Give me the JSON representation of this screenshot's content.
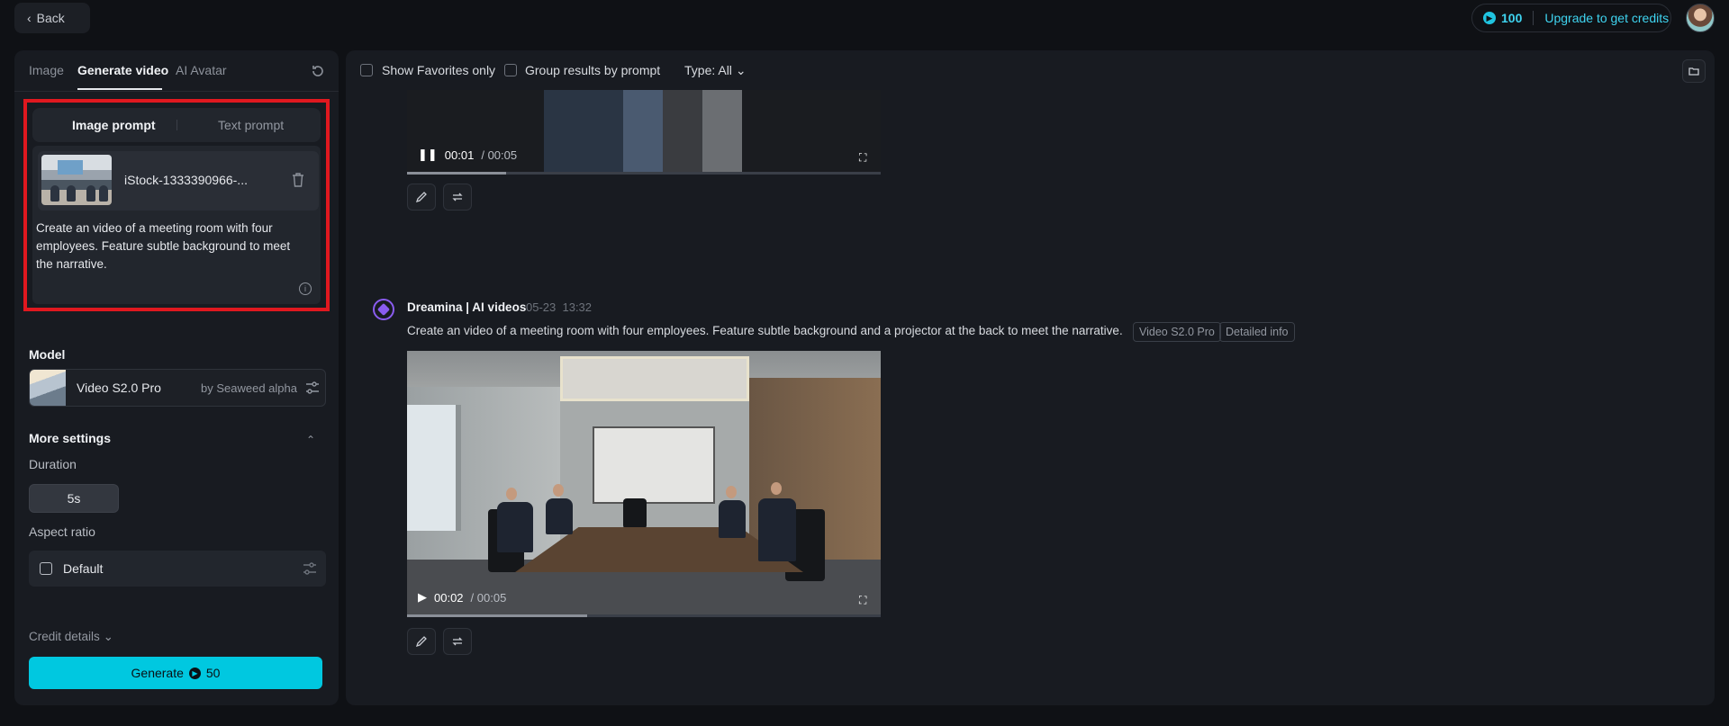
{
  "topbar": {
    "back_label": "Back",
    "credits": "100",
    "upgrade_label": "Upgrade to get credits"
  },
  "left": {
    "tabs": [
      {
        "label": "Image"
      },
      {
        "label": "Generate video"
      },
      {
        "label": "AI Avatar"
      }
    ],
    "prompt_tabs": {
      "image": "Image prompt",
      "text": "Text prompt"
    },
    "file_name": "iStock-1333390966-...",
    "prompt_text": "Create an video of a meeting room with four employees. Feature subtle background to meet the narrative.",
    "model_section": "Model",
    "model_name": "Video S2.0 Pro",
    "model_by": "by Seaweed alpha",
    "more_settings": "More settings",
    "duration_label": "Duration",
    "duration_value": "5s",
    "aspect_label": "Aspect ratio",
    "aspect_value": "Default",
    "credit_details": "Credit details",
    "generate_label": "Generate",
    "generate_cost": "50"
  },
  "main": {
    "show_favorites": "Show Favorites only",
    "group_results": "Group results by prompt",
    "type_filter": "Type: All",
    "video1": {
      "time_current": "00:01",
      "time_total": "/ 00:05",
      "progress": 0.21
    },
    "result": {
      "title": "Dreamina | AI videos",
      "date": "05-23",
      "time": "13:32",
      "prompt": "Create an video of a meeting room with four employees. Feature subtle background and a projector at the back to meet the narrative.",
      "tag_model": "Video S2.0 Pro",
      "tag_info": "Detailed info"
    },
    "video2": {
      "time_current": "00:02",
      "time_total": "/ 00:05",
      "progress": 0.38
    }
  }
}
